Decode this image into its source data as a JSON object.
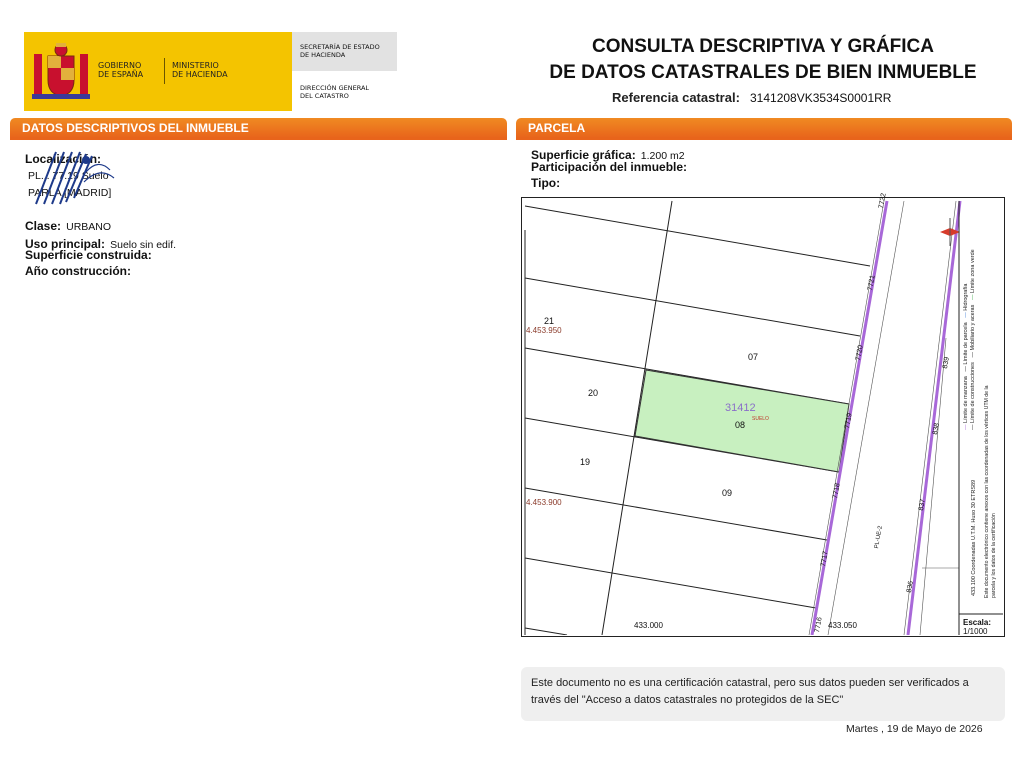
{
  "header": {
    "gobierno": [
      "GOBIERNO",
      "DE ESPAÑA"
    ],
    "ministerio": [
      "MINISTERIO",
      "DE HACIENDA"
    ],
    "secretaria": [
      "SECRETARÍA DE ESTADO",
      "DE HACIENDA"
    ],
    "direccion": [
      "DIRECCIÓN GENERAL",
      "DEL CATASTRO"
    ],
    "title_line1": "CONSULTA DESCRIPTIVA Y GRÁFICA",
    "title_line2": "DE DATOS CATASTRALES DE BIEN INMUEBLE",
    "ref_label": "Referencia catastral:",
    "ref_value": "3141208VK3534S0001RR"
  },
  "left": {
    "tab": "DATOS DESCRIPTIVOS DEL INMUEBLE",
    "localizacion_label": "Localización:",
    "localizacion_line1": "PL... 77.19 Suelo",
    "localizacion_line2": "PARLA [MADRID]",
    "clase_label": "Clase:",
    "clase_value": "URBANO",
    "uso_label": "Uso principal:",
    "uso_value": "Suelo sin edif.",
    "sup_label": "Superficie construida:",
    "anio_label": "Año construcción:"
  },
  "right": {
    "tab": "PARCELA",
    "superficie_label": "Superficie gráfica:",
    "superficie_value": "1.200 m2",
    "participacion_label": "Participación del inmueble:",
    "tipo_label": "Tipo:"
  },
  "map": {
    "parcel_label": "31412",
    "parcel_sub": "SUELO",
    "lot_labels": [
      "21",
      "20",
      "19",
      "07",
      "08",
      "09"
    ],
    "coord_y1": "4.453.950",
    "coord_y2": "4.453.900",
    "coord_x1": "433.000",
    "coord_x2": "433.050",
    "road_numbers": [
      "7722",
      "7721",
      "7720",
      "7719",
      "7718",
      "7717",
      "7716",
      "839",
      "838",
      "837",
      "836"
    ],
    "street": "PL-UE-2",
    "legend": [
      "Límite de manzana",
      "Límite de parcela",
      "Hidrografía",
      "Límite de construcciones",
      "Mobiliario y aceras",
      "Límite zona verde"
    ],
    "legend_note": "Este documento electrónico contiene anexos con las coordenadas de los vértices UTM de la parcela y los datos de la certificación",
    "coords_note": "433.100 Coordenadas U.T.M. Huso 30 ETRS89",
    "scale_label": "Escala:",
    "scale_value": "1/1000"
  },
  "notice": "Este documento no es una certificación catastral, pero sus datos pueden ser verificados a través del \"Acceso a datos catastrales no protegidos de la SEC\"",
  "date": "Martes , 19 de Mayo de 2026",
  "colors": {
    "orange": "#e8641b",
    "parcel_fill": "#c8f0c0",
    "road": "#a868d8"
  }
}
